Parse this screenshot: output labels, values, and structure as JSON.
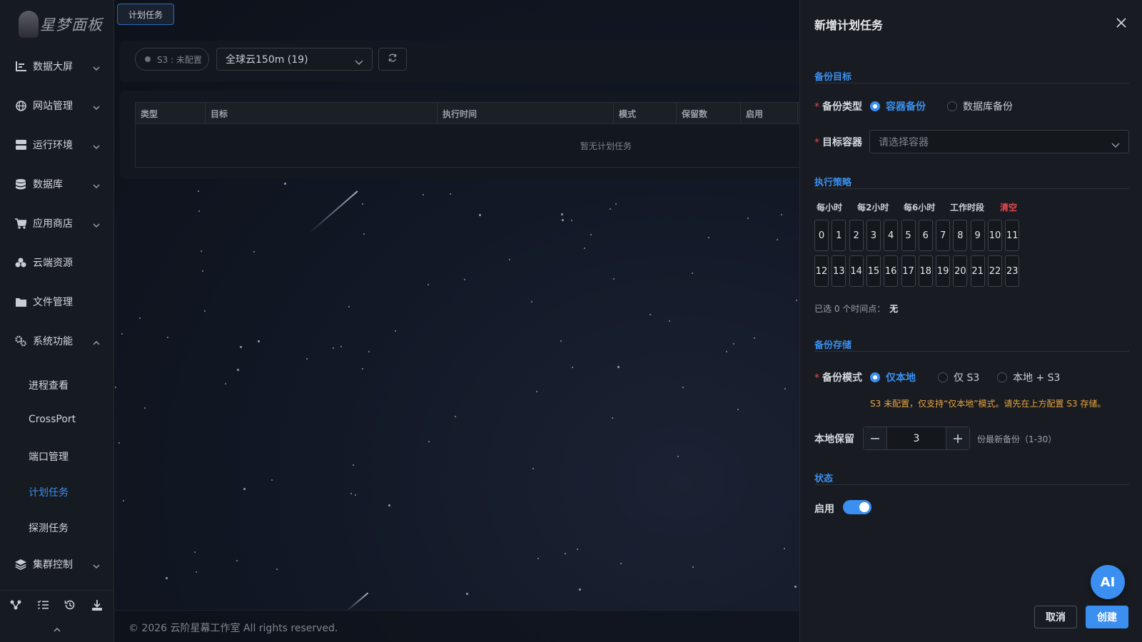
{
  "sidebar": {
    "logo_text": "星梦面板",
    "items": [
      {
        "label": "数据大屏",
        "icon": "chart-icon"
      },
      {
        "label": "网站管理",
        "icon": "globe-icon"
      },
      {
        "label": "运行环境",
        "icon": "server-icon"
      },
      {
        "label": "数据库",
        "icon": "database-icon"
      },
      {
        "label": "应用商店",
        "icon": "cart-icon"
      },
      {
        "label": "云端资源",
        "icon": "cloud-icon"
      },
      {
        "label": "文件管理",
        "icon": "folder-icon"
      },
      {
        "label": "系统功能",
        "icon": "gears-icon"
      },
      {
        "label": "集群控制",
        "icon": "layers-icon"
      }
    ],
    "sub_items": [
      "进程查看",
      "CrossPort",
      "端口管理",
      "计划任务",
      "探测任务"
    ],
    "active_sub": "计划任务"
  },
  "top_tab": {
    "label": "计划任务"
  },
  "toolbar": {
    "s3_status": "S3 : 未配置",
    "server_select": "全球云150m (19)"
  },
  "table": {
    "columns": [
      "类型",
      "目标",
      "执行时间",
      "模式",
      "保留数",
      "启用"
    ],
    "empty_text": "暂无计划任务"
  },
  "footer": {
    "copyright": "© 2026 云阶星幕工作室 All rights reserved."
  },
  "drawer": {
    "title": "新增计划任务",
    "section_target": "备份目标",
    "backup_type_label": "备份类型",
    "backup_type_options": [
      "容器备份",
      "数据库备份"
    ],
    "backup_type_selected": "容器备份",
    "target_container_label": "目标容器",
    "target_container_placeholder": "请选择容器",
    "section_policy": "执行策略",
    "presets": [
      "每小时",
      "每2小时",
      "每6小时",
      "工作时段"
    ],
    "clear_label": "清空",
    "hours_row1": [
      "0",
      "1",
      "2",
      "3",
      "4",
      "5",
      "6",
      "7",
      "8",
      "9",
      "10",
      "11"
    ],
    "hours_row2": [
      "12",
      "13",
      "14",
      "15",
      "16",
      "17",
      "18",
      "19",
      "20",
      "21",
      "22",
      "23"
    ],
    "selected_label": "已选 0 个时间点：",
    "selected_value": "无",
    "section_storage": "备份存储",
    "backup_mode_label": "备份模式",
    "backup_mode_options": [
      "仅本地",
      "仅 S3",
      "本地 + S3"
    ],
    "backup_mode_selected": "仅本地",
    "s3_warning": "S3 未配置，仅支持“仅本地”模式。请先在上方配置 S3 存储。",
    "local_keep_label": "本地保留",
    "local_keep_value": "3",
    "local_keep_hint": "份最新备份（1-30）",
    "section_status": "状态",
    "enable_label": "启用",
    "enabled": true,
    "ai_label": "AI",
    "cancel_label": "取消",
    "create_label": "创建"
  },
  "colors": {
    "accent": "#3a8ff0",
    "warning": "#e8a33c",
    "danger": "#e5484d"
  }
}
